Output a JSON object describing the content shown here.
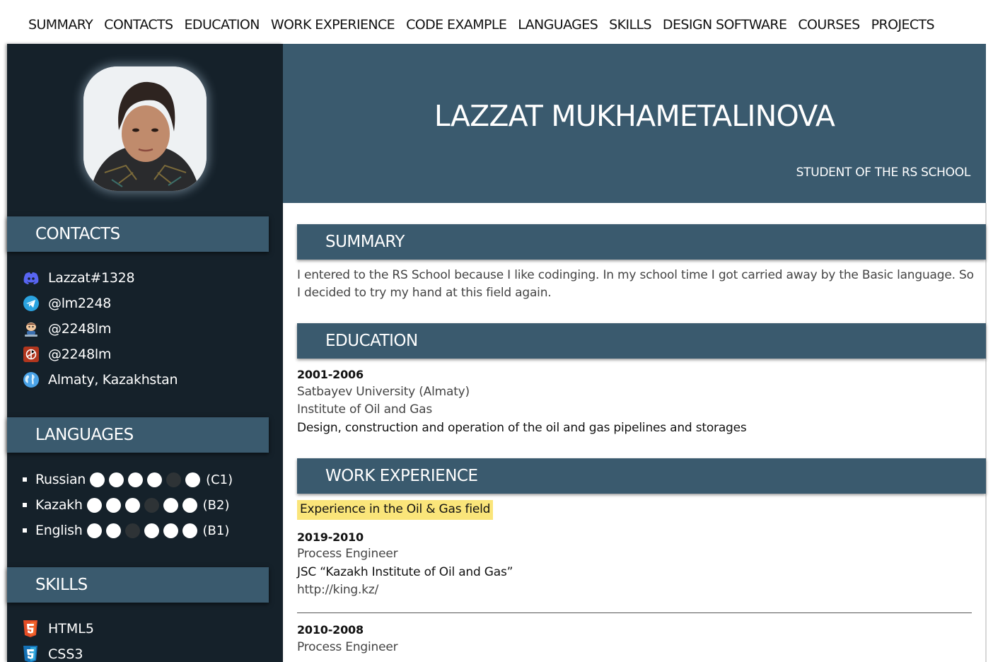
{
  "nav": {
    "items": [
      "SUMMARY",
      "CONTACTS",
      "EDUCATION",
      "WORK EXPERIENCE",
      "CODE EXAMPLE",
      "LANGUAGES",
      "SKILLS",
      "DESIGN SOFTWARE",
      "COURSES",
      "PROJECTS"
    ]
  },
  "header": {
    "name": "LAZZAT MUKHAMETALINOVA",
    "role": "STUDENT OF THE RS SCHOOL"
  },
  "sidebar": {
    "contacts_title": "CONTACTS",
    "contacts": [
      {
        "icon": "discord-icon",
        "text": "Lazzat#1328"
      },
      {
        "icon": "telegram-icon",
        "text": "@lm2248"
      },
      {
        "icon": "github-icon",
        "text": "@2248lm"
      },
      {
        "icon": "codewars-icon",
        "text": "@2248lm"
      },
      {
        "icon": "globe-icon",
        "text": "Almaty, Kazakhstan"
      }
    ],
    "languages_title": "LANGUAGES",
    "languages": [
      {
        "name": "Russian",
        "dots": [
          1,
          1,
          1,
          1,
          0,
          1
        ],
        "level": "(C1)"
      },
      {
        "name": "Kazakh",
        "dots": [
          1,
          1,
          1,
          0,
          1,
          1
        ],
        "level": "(B2)"
      },
      {
        "name": "English",
        "dots": [
          1,
          1,
          0,
          1,
          1,
          1
        ],
        "level": "(B1)"
      }
    ],
    "skills_title": "SKILLS",
    "skills": [
      {
        "icon": "html5-icon",
        "text": "HTML5"
      },
      {
        "icon": "css3-icon",
        "text": "CSS3"
      }
    ]
  },
  "summary": {
    "title": "SUMMARY",
    "text": "I entered to the RS School because I like codinging. In my school time I got carried away by the Basic language. So I decided to try my hand at this field again."
  },
  "education": {
    "title": "EDUCATION",
    "years": "2001-2006",
    "university": "Satbayev University (Almaty)",
    "institute": "Institute of Oil and Gas",
    "program": "Design, construction and operation of the oil and gas pipelines and storages"
  },
  "work": {
    "title": "WORK EXPERIENCE",
    "highlight": "Experience in the Oil & Gas field",
    "jobs": [
      {
        "years": "2019-2010",
        "position": "Process Engineer",
        "company": "JSC “Kazakh Institute of Oil and Gas”",
        "url": "http://king.kz/"
      },
      {
        "years": "2010-2008",
        "position": "Process Engineer",
        "company": "",
        "url": ""
      }
    ]
  },
  "colors": {
    "accent": "#3a5a6e",
    "sidebar_bg": "#15212a",
    "highlight": "#fae57a"
  }
}
